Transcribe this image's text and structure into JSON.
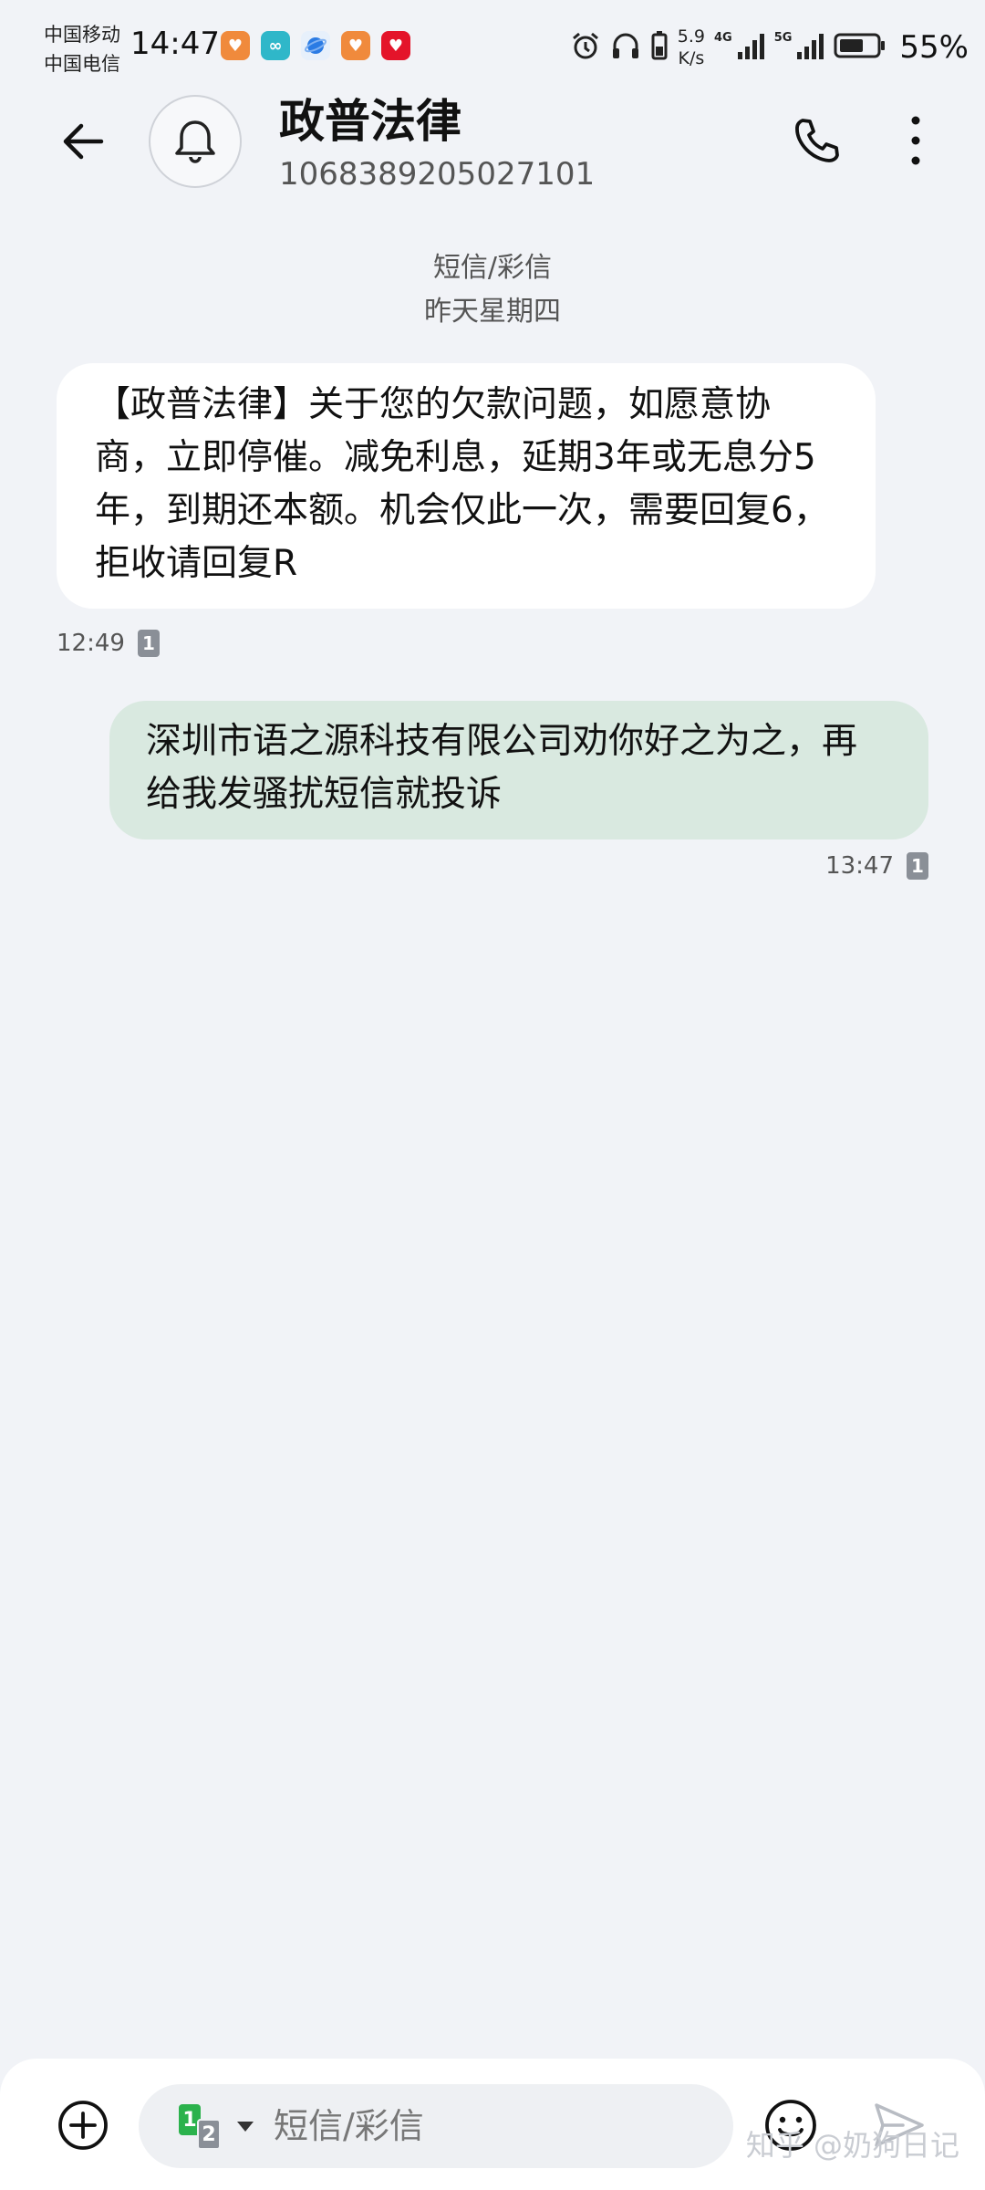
{
  "status_bar": {
    "carrier_1": "中国移动",
    "carrier_2": "中国电信",
    "time": "14:47",
    "net_speed_value": "5.9",
    "net_speed_unit": "K/s",
    "sim1_network": "4G",
    "sim2_network": "5G",
    "battery": "55%",
    "app_icons": [
      "taobao-heart",
      "link",
      "planet",
      "taobao-heart",
      "netease-music"
    ],
    "status_icons": [
      "alarm-icon",
      "headphones-icon",
      "battery-saver-icon"
    ]
  },
  "header": {
    "contact_name": "政普法律",
    "contact_number": "1068389205027101",
    "avatar_icon": "bell-icon"
  },
  "thread": {
    "type_label": "短信/彩信",
    "date_label": "昨天星期四",
    "messages": [
      {
        "direction": "incoming",
        "text": "【政普法律】关于您的欠款问题，如愿意协商，立即停催。减免利息，延期3年或无息分5年，到期还本额。机会仅此一次，需要回复6，拒收请回复R",
        "time": "12:49",
        "sim": "1"
      },
      {
        "direction": "outgoing",
        "text": "深圳市语之源科技有限公司劝你好之为之，再给我发骚扰短信就投诉",
        "time": "13:47",
        "sim": "1"
      }
    ]
  },
  "composer": {
    "placeholder": "短信/彩信",
    "value": "",
    "sim_primary": "1",
    "sim_secondary": "2"
  },
  "watermark": "知乎 @奶狗日记",
  "colors": {
    "background": "#f1f3f7",
    "incoming_bubble": "#ffffff",
    "outgoing_bubble": "#d9e9e0",
    "sim1_badge": "#2bb24c"
  }
}
